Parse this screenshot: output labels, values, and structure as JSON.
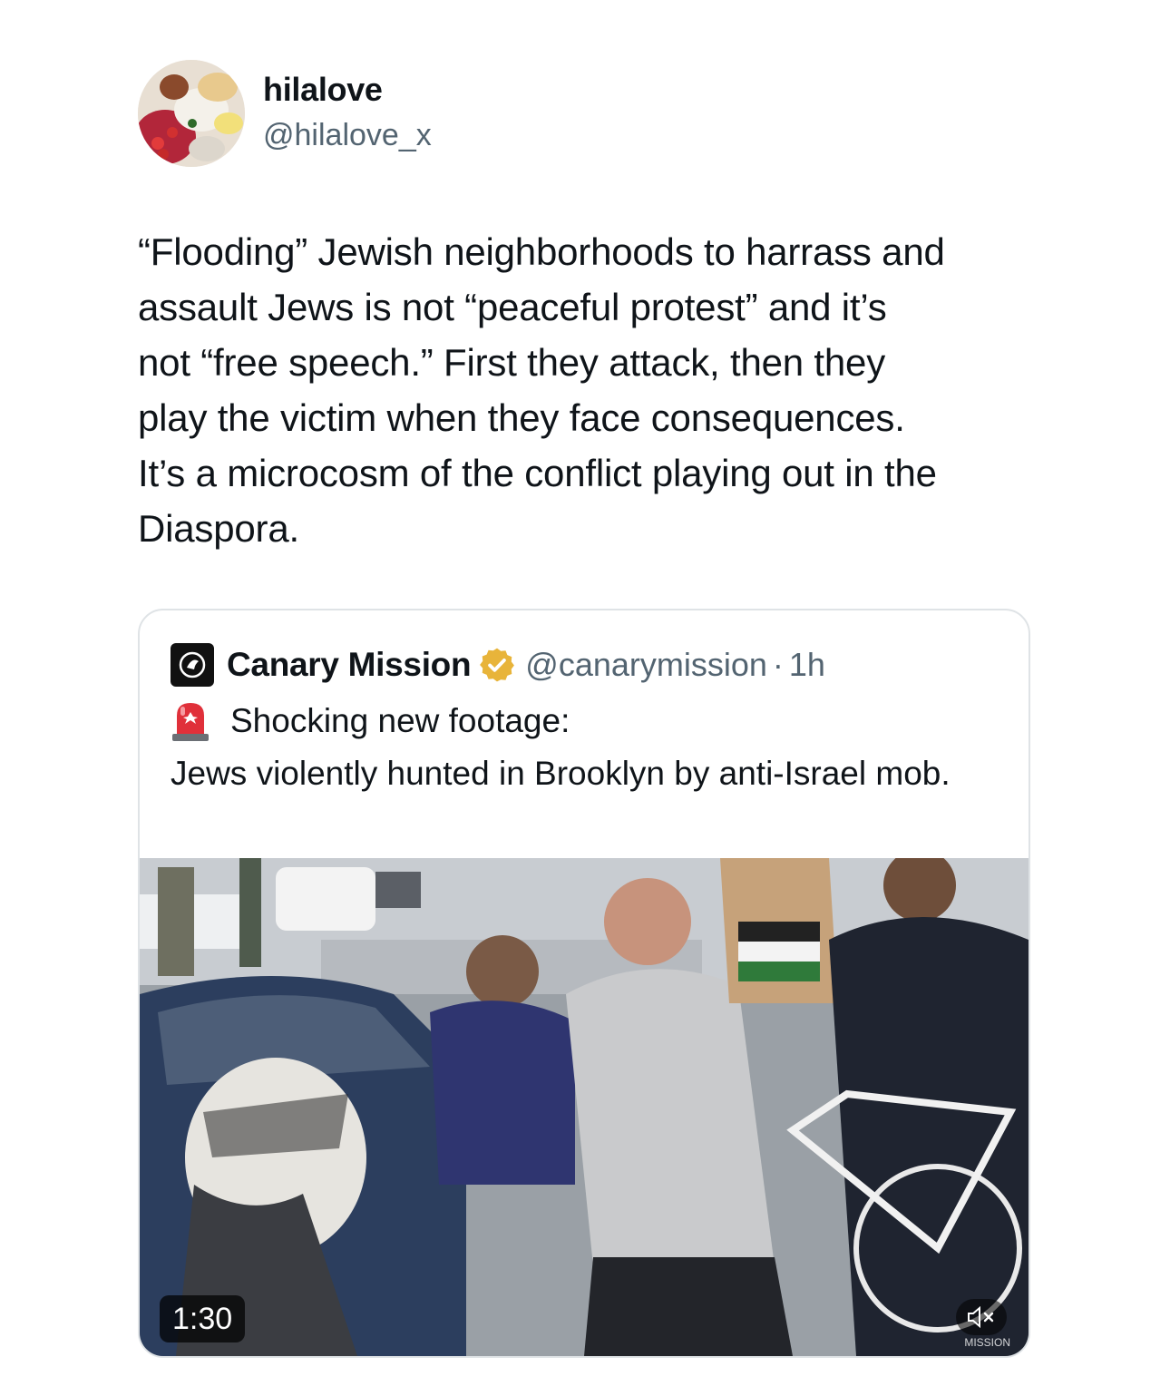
{
  "tweet": {
    "display_name": "hilalove",
    "handle": "@hilalove_x",
    "text": "“Flooding” Jewish neighborhoods to harrass and\nassault Jews is not “peaceful protest” and it’s\nnot “free speech.” First they attack, then they\nplay the victim when they face consequences.\nIt’s a microcosm of the conflict playing out in the\nDiaspora."
  },
  "quote": {
    "display_name": "Canary Mission",
    "handle": "@canarymission",
    "separator": "·",
    "time": "1h",
    "line1": "Shocking new footage:",
    "text": "Jews violently hunted in Brooklyn by anti-Israel mob.",
    "media": {
      "duration": "1:30"
    }
  },
  "icons": {
    "verified": "verified-gold-badge-icon",
    "siren": "police-siren-emoji",
    "mute": "speaker-muted-icon"
  },
  "colors": {
    "verified_gold": "#e8b43a",
    "secondary_text": "#536471",
    "siren_red": "#e0303a"
  }
}
